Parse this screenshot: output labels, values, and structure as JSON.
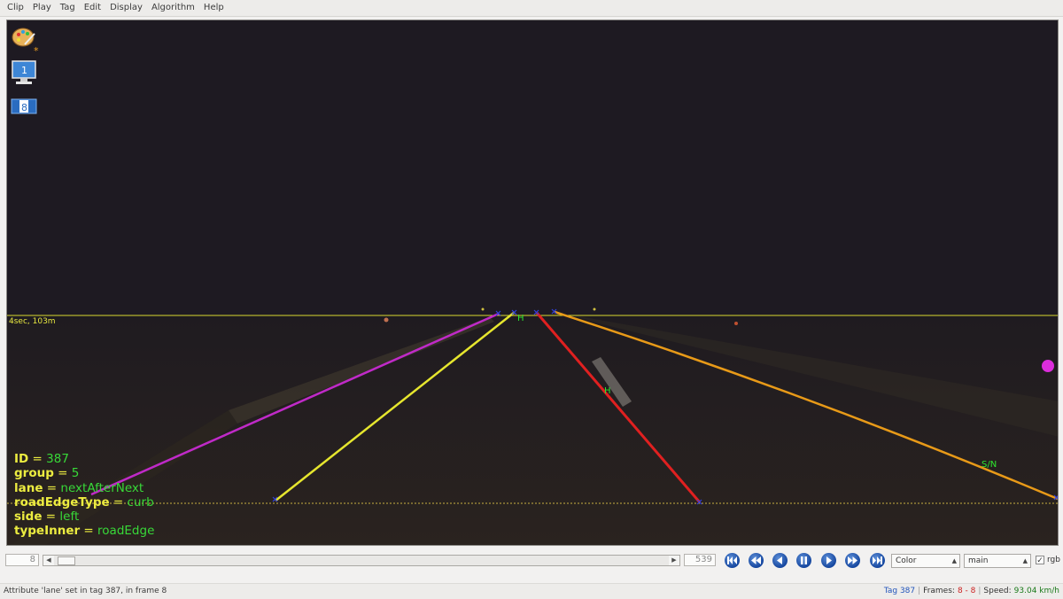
{
  "menu": [
    "Clip",
    "Play",
    "Tag",
    "Edit",
    "Display",
    "Algorithm",
    "Help"
  ],
  "viewer": {
    "horizon_label": "4sec, 103m",
    "markers": [
      "H",
      "H",
      "S/N"
    ],
    "icons": [
      "paint-palette-icon",
      "monitor-1-icon",
      "view-8-icon"
    ],
    "monitor_badge": "1",
    "view_badge": "8",
    "attributes": [
      {
        "key": "ID",
        "value": "387"
      },
      {
        "key": "group",
        "value": "5"
      },
      {
        "key": "lane",
        "value": "nextAfterNext"
      },
      {
        "key": "roadEdgeType",
        "value": "curb"
      },
      {
        "key": "side",
        "value": "left"
      },
      {
        "key": "typeInner",
        "value": "roadEdge"
      }
    ],
    "line_colors": {
      "magenta": "#c02ac8",
      "yellow": "#e6e62e",
      "red": "#e02020",
      "orange": "#e89a18"
    }
  },
  "controls": {
    "frame_start": "8",
    "frame_end": "539",
    "playback_buttons": [
      "first-frame",
      "rewind",
      "step-back",
      "pause",
      "play",
      "fast-forward",
      "last-frame"
    ],
    "color_mode": "Color",
    "stream": "main",
    "rgb_checked": true,
    "rgb_label": "rgb"
  },
  "status": {
    "message": "Attribute 'lane' set in tag 387, in frame 8",
    "tag": "Tag 387",
    "frames_label": "Frames:",
    "frames_value": "8 - 8",
    "speed_label": "Speed:",
    "speed_value": "93.04 km/h"
  }
}
